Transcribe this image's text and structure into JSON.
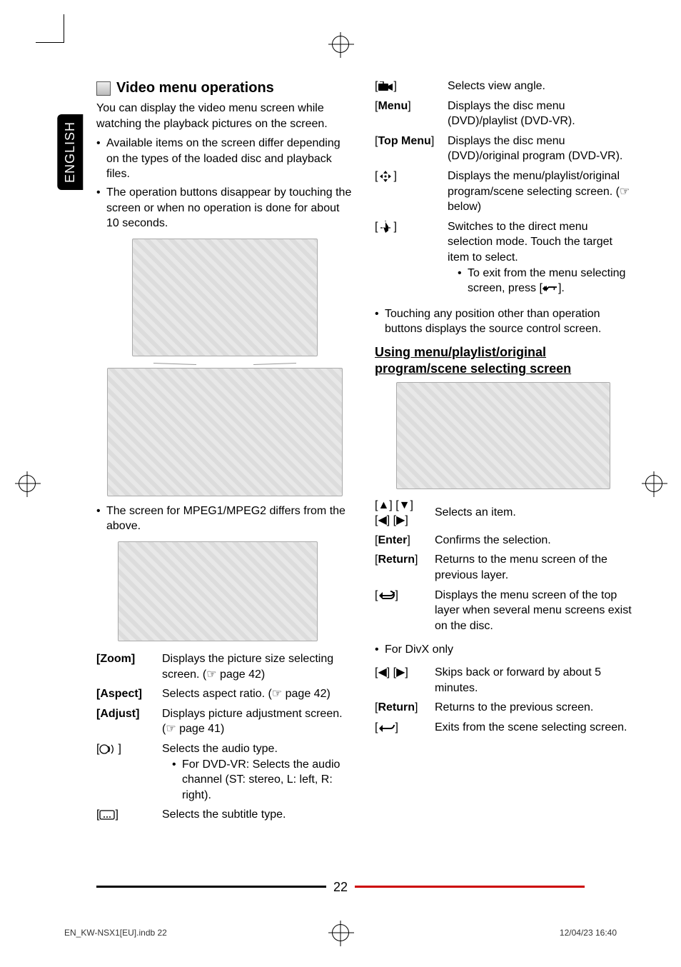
{
  "language_tab": "ENGLISH",
  "left": {
    "section_title": "Video menu operations",
    "intro": "You can display the video menu screen while watching the playback pictures on the screen.",
    "bullets": [
      "Available items on the screen differ depending on the types of the loaded disc and playback files.",
      "The operation buttons disappear by touching the screen or when no operation is done for about 10 seconds."
    ],
    "note": "The screen for MPEG1/MPEG2 differs from the above.",
    "defs": [
      {
        "key": "[Zoom]",
        "val": "Displays the picture size selecting screen. (☞ page 42)"
      },
      {
        "key": "[Aspect]",
        "val": "Selects aspect ratio. (☞ page 42)"
      },
      {
        "key": "[Adjust]",
        "val": "Displays picture adjustment screen. (☞ page 41)"
      }
    ],
    "audio": {
      "val": "Selects the audio type.",
      "sub": "For DVD-VR: Selects the audio channel (ST: stereo, L: left, R: right)."
    },
    "subtitle": {
      "val": "Selects the subtitle type."
    }
  },
  "right": {
    "defs_top": {
      "angle": "Selects view angle.",
      "menu_key": "[Menu]",
      "menu_val": "Displays the disc menu (DVD)/playlist (DVD-VR).",
      "topmenu_key": "[Top Menu]",
      "topmenu_val": "Displays the disc menu (DVD)/original program (DVD-VR).",
      "nav_val": "Displays the menu/playlist/original program/scene selecting screen. (☞ below)",
      "direct_val": "Switches to the direct menu selection mode. Touch the target item to select.",
      "direct_sub": "To exit from the menu selecting screen, press [",
      "direct_sub_end": "]."
    },
    "note": "Touching any position other than operation buttons displays the source control screen.",
    "subsection_title": "Using menu/playlist/original program/scene selecting screen",
    "defs_mid": {
      "arrows": "Selects an item.",
      "enter_key": "[Enter]",
      "enter_val": "Confirms the selection.",
      "return_key": "[Return]",
      "return_val": "Returns to the menu screen of the previous layer.",
      "back_val": "Displays the menu screen of the top layer when several menu screens exist on the disc."
    },
    "divx_header": "For DivX only",
    "defs_divx": {
      "lr_val": "Skips back or forward by about 5 minutes.",
      "return_key": "[Return]",
      "return_val": "Returns to the previous screen.",
      "back_val": "Exits from the scene selecting screen."
    }
  },
  "page_number": "22",
  "footer_left": "EN_KW-NSX1[EU].indb   22",
  "footer_right": "12/04/23   16:40"
}
